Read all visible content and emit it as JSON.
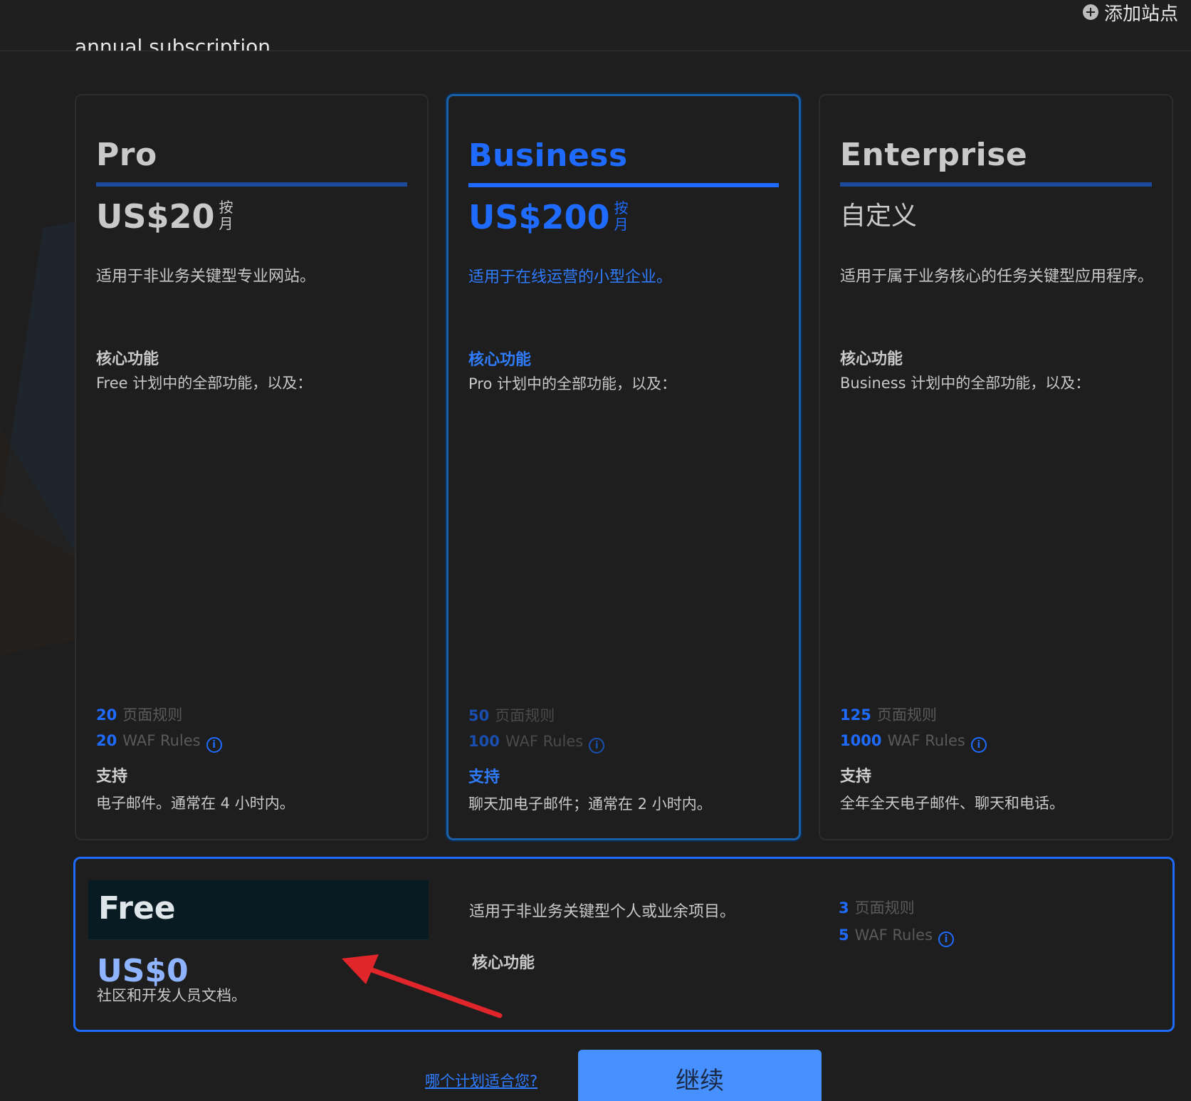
{
  "topbar": {
    "add_site_label": "添加站点",
    "cut_off_text": "annual subscription."
  },
  "plans": [
    {
      "name": "Pro",
      "price": "US$20",
      "per": "按月",
      "description": "适用于非业务关键型专业网站。",
      "core_title": "核心功能",
      "core_sub": "Free 计划中的全部功能，以及：",
      "page_rules_num": "20",
      "page_rules_label": "页面规则",
      "waf_num": "20",
      "waf_label": "WAF Rules",
      "support_title": "支持",
      "support_text": "电子邮件。通常在 4 小时内。"
    },
    {
      "name": "Business",
      "price": "US$200",
      "per": "按月",
      "description": "适用于在线运营的小型企业。",
      "core_title": "核心功能",
      "core_sub": "Pro 计划中的全部功能，以及：",
      "page_rules_num": "50",
      "page_rules_label": "页面规则",
      "waf_num": "100",
      "waf_label": "WAF Rules",
      "support_title": "支持",
      "support_text": "聊天加电子邮件；通常在 2 小时内。"
    },
    {
      "name": "Enterprise",
      "price": "自定义",
      "description": "适用于属于业务核心的任务关键型应用程序。",
      "core_title": "核心功能",
      "core_sub": "Business 计划中的全部功能，以及：",
      "page_rules_num": "125",
      "page_rules_label": "页面规则",
      "waf_num": "1000",
      "waf_label": "WAF Rules",
      "support_title": "支持",
      "support_text": "全年全天电子邮件、聊天和电话。"
    }
  ],
  "free_plan": {
    "name": "Free",
    "price": "US$0",
    "docs_text": "社区和开发人员文档。",
    "description": "适用于非业务关键型个人或业余项目。",
    "core_title": "核心功能",
    "page_rules_num": "3",
    "page_rules_label": "页面规则",
    "waf_num": "5",
    "waf_label": "WAF Rules"
  },
  "footer": {
    "which_plan_link": "哪个计划适合您?",
    "continue_label": "继续"
  },
  "colors": {
    "accent": "#1f6bff",
    "annotation_arrow": "#e0262a"
  },
  "icons": {
    "info": "info-circle-icon",
    "add": "plus-circle-icon"
  }
}
